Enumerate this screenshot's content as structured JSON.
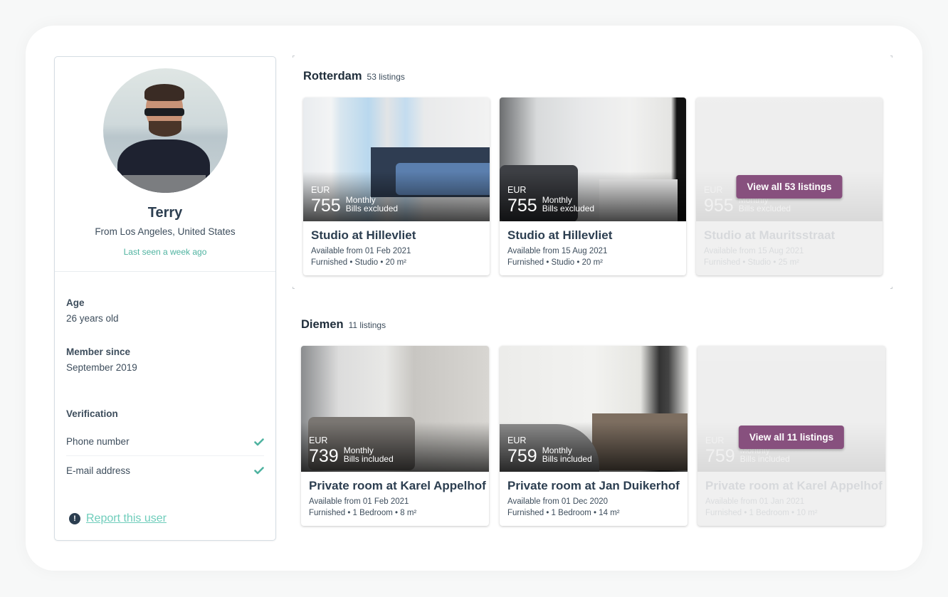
{
  "profile": {
    "name": "Terry",
    "from": "From Los Angeles, United States",
    "last_seen": "Last seen a week ago",
    "age_label": "Age",
    "age_value": "26 years old",
    "member_label": "Member since",
    "member_value": "September 2019",
    "verification_label": "Verification",
    "verifications": [
      {
        "label": "Phone number",
        "verified": true
      },
      {
        "label": "E-mail address",
        "verified": true
      }
    ],
    "report_label": "Report this user"
  },
  "colors": {
    "accent_teal": "#4fb3a0",
    "link": "#6fcdbb",
    "button_purple": "#87507e",
    "text_dark": "#2c3e50"
  },
  "sections": [
    {
      "city": "Rotterdam",
      "count": "53 listings",
      "listings": [
        {
          "currency": "EUR",
          "price": "755",
          "period": "Monthly",
          "bills": "Bills excluded",
          "title": "Studio at Hillevliet",
          "available": "Available from 01 Feb 2021",
          "spec": "Furnished • Studio • 20 m²"
        },
        {
          "currency": "EUR",
          "price": "755",
          "period": "Monthly",
          "bills": "Bills excluded",
          "title": "Studio at Hillevliet",
          "available": "Available from 15 Aug 2021",
          "spec": "Furnished • Studio • 20 m²"
        },
        {
          "currency": "EUR",
          "price": "955",
          "period": "Monthly",
          "bills": "Bills excluded",
          "title": "Studio at Mauritsstraat",
          "available": "Available from 15 Aug 2021",
          "spec": "Furnished • Studio • 25 m²"
        }
      ],
      "view_all": "View all 53 listings"
    },
    {
      "city": "Diemen",
      "count": "11 listings",
      "listings": [
        {
          "currency": "EUR",
          "price": "739",
          "period": "Monthly",
          "bills": "Bills included",
          "title": "Private room at Karel Appelhof",
          "available": "Available from 01 Feb 2021",
          "spec": "Furnished • 1 Bedroom • 8 m²"
        },
        {
          "currency": "EUR",
          "price": "759",
          "period": "Monthly",
          "bills": "Bills included",
          "title": "Private room at Jan Duikerhof",
          "available": "Available from 01 Dec 2020",
          "spec": "Furnished • 1 Bedroom • 14 m²"
        },
        {
          "currency": "EUR",
          "price": "759",
          "period": "Monthly",
          "bills": "Bills included",
          "title": "Private room at Karel Appelhof",
          "available": "Available from 01 Jan 2021",
          "spec": "Furnished • 1 Bedroom • 10 m²"
        }
      ],
      "view_all": "View all 11 listings"
    }
  ]
}
